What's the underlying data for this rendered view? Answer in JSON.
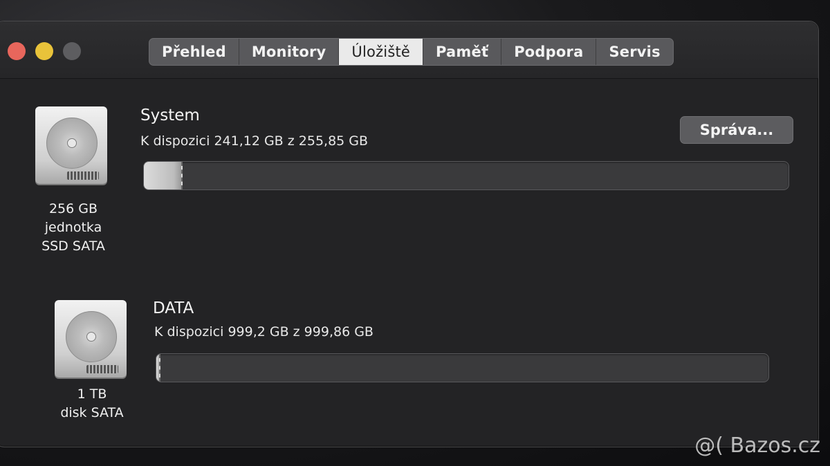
{
  "tabs": [
    "Přehled",
    "Monitory",
    "Úložiště",
    "Paměť",
    "Podpora",
    "Servis"
  ],
  "active_tab_index": 2,
  "volumes": [
    {
      "name": "System",
      "availability": "K dispozici 241,12 GB z 255,85 GB",
      "used_fraction": 0.058,
      "drive_caption": [
        "256 GB",
        "jednotka",
        "SSD SATA"
      ]
    },
    {
      "name": "DATA",
      "availability": "K dispozici 999,2 GB z 999,86 GB",
      "used_fraction": 0.001,
      "drive_caption": [
        "1 TB",
        "disk SATA"
      ]
    }
  ],
  "manage_button": "Správa...",
  "watermark": "@( Bazos.cz",
  "colors": {
    "close": "#e8665c",
    "minimize": "#e9c33a",
    "zoom_inactive": "#5d5d60"
  },
  "icons": [
    "hard-drive-icon"
  ]
}
